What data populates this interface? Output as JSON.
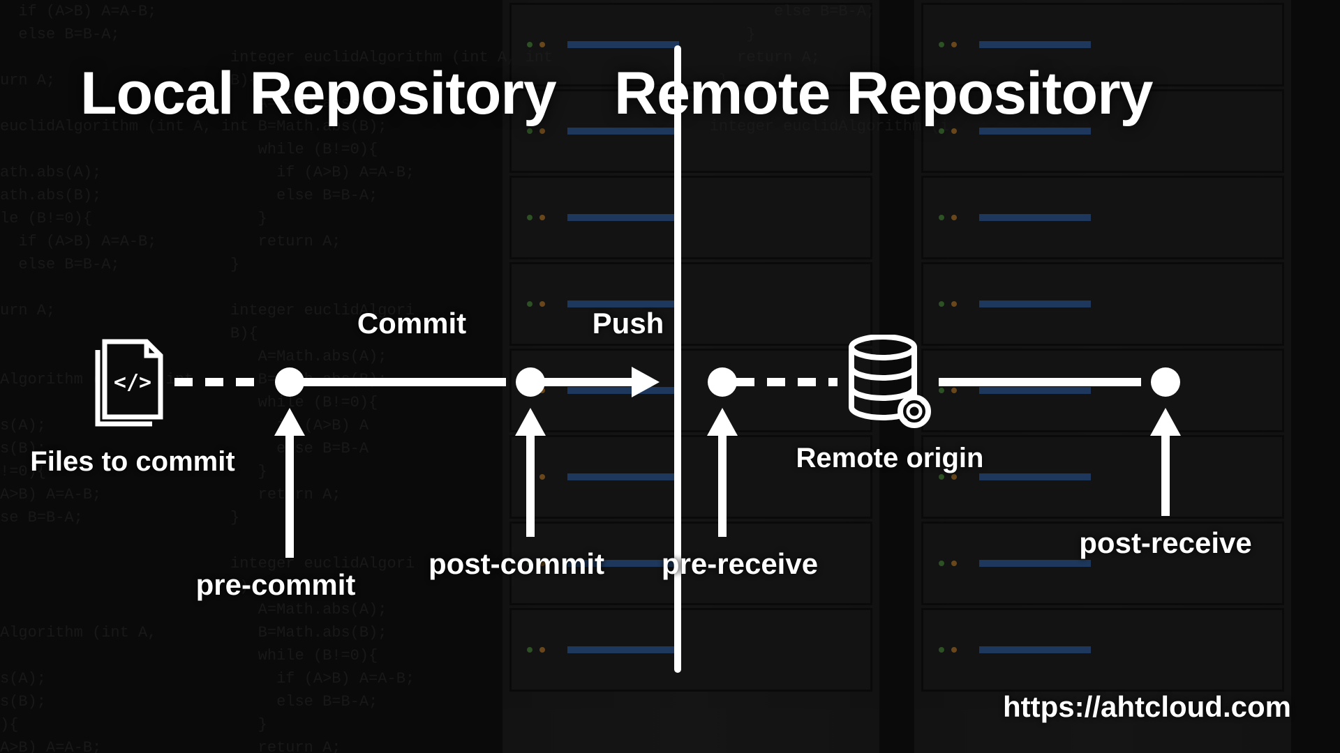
{
  "titles": {
    "local": "Local Repository",
    "remote": "Remote Repository"
  },
  "nodes": {
    "files": "Files to commit",
    "remote_origin": "Remote origin"
  },
  "actions": {
    "commit": "Commit",
    "push": "Push"
  },
  "hooks": {
    "pre_commit": "pre-commit",
    "post_commit": "post-commit",
    "pre_receive": "pre-receive",
    "post_receive": "post-receive"
  },
  "url": "https://ahtcloud.com",
  "bg_code": "  if (A>B) A=A-B;                                                                   else B=B-A;\n  else B=B-A;                                                                    }\n                         integer euclidAlgorithm (int A, int                    return A;\nurn A;                   B){                                                  }\n                            A=Math.abs(A);\neuclidAlgorithm (int A, int B=Math.abs(B);                                   integer euclidAlgorithm (i\n                            while (B!=0){\nath.abs(A);                   if (A>B) A=A-B;\nath.abs(B);                   else B=B-A;\nle (B!=0){                  }\n  if (A>B) A=A-B;           return A;\n  else B=B-A;            }\n\nurn A;                   integer euclidAlgori\n                         B){\n                            A=Math.abs(A);\nAlgorithm (int A, int       B=Math.abs(B);\n                            while (B!=0){\ns(A);                         if (A>B) A\ns(B);                         else B=B-A\n!=0){                       }\nA>B) A=A-B;                 return A;\nse B=B-A;                }\n\n                         integer euclidAlgori\n                         B){\n                            A=Math.abs(A);\nAlgorithm (int A,           B=Math.abs(B);\n                            while (B!=0){\ns(A);                         if (A>B) A=A-B;\ns(B);                         else B=B-A;\n){                          }\nA>B) A=A-B;                 return A;"
}
